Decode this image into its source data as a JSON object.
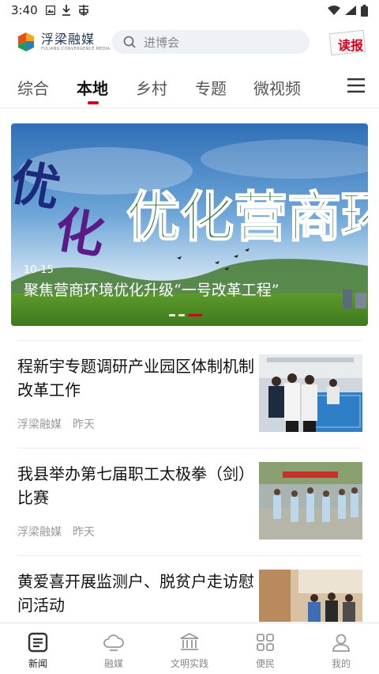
{
  "status_bar": {
    "time": "3:40"
  },
  "header": {
    "logo_text": "浮梁融媒",
    "logo_subtext": "FULIANG CONVERGENCE MEDIA",
    "search_placeholder": "进博会",
    "read_paper_label": "读报"
  },
  "tabs": [
    {
      "label": "综合",
      "active": false
    },
    {
      "label": "本地",
      "active": true
    },
    {
      "label": "乡村",
      "active": false
    },
    {
      "label": "专题",
      "active": false
    },
    {
      "label": "微视频",
      "active": false
    }
  ],
  "banner": {
    "image_text": "优化营商环境",
    "date": "10-15",
    "caption": "聚焦营商环境优化升级“一号改革工程”"
  },
  "news": [
    {
      "title": "程新宇专题调研产业园区体制机制改革工作",
      "source": "浮梁融媒",
      "time": "昨天"
    },
    {
      "title": "我县举办第七届职工太极拳（剑）比赛",
      "source": "浮梁融媒",
      "time": "昨天"
    },
    {
      "title": "黄爱喜开展监测户、脱贫户走访慰问活动",
      "source": "",
      "time": ""
    }
  ],
  "bottom_nav": [
    {
      "label": "新闻",
      "icon": "news-icon",
      "active": true
    },
    {
      "label": "融媒",
      "icon": "cloud-icon",
      "active": false
    },
    {
      "label": "文明实践",
      "icon": "building-icon",
      "active": false
    },
    {
      "label": "便民",
      "icon": "grid-icon",
      "active": false
    },
    {
      "label": "我的",
      "icon": "person-icon",
      "active": false
    }
  ],
  "colors": {
    "accent": "#d0021b",
    "brand_navy": "#1d3557"
  }
}
